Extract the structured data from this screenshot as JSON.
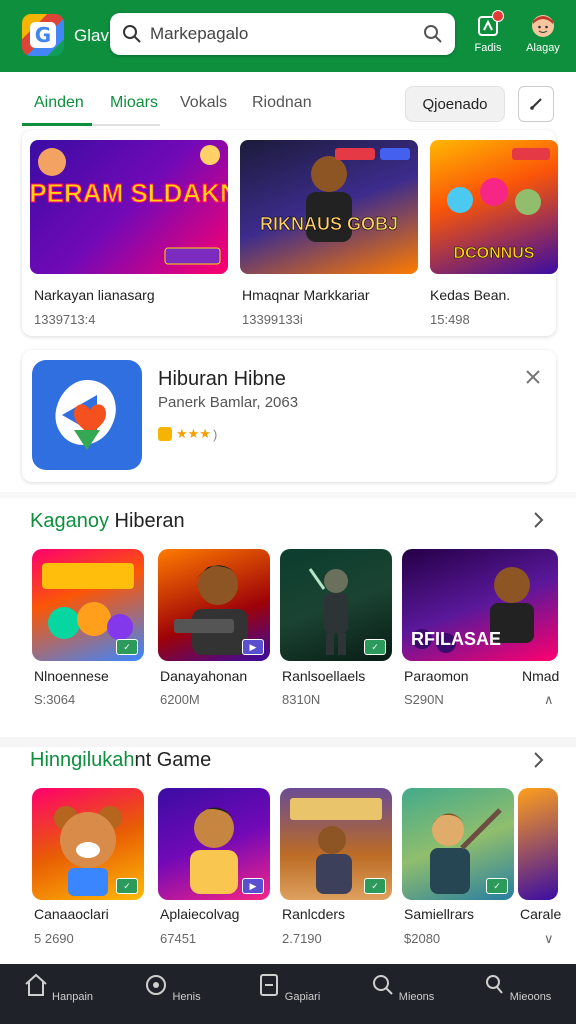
{
  "header": {
    "brand": "Glavn",
    "search_placeholder": "Markepagalo",
    "icons": [
      {
        "name": "notifications-icon",
        "label": "Fadis"
      },
      {
        "name": "avatar",
        "label": "Alagay"
      }
    ]
  },
  "tabs": [
    {
      "label": "Ainden",
      "active": true
    },
    {
      "label": "Mioars",
      "active": false
    },
    {
      "label": "Vokals",
      "active": false
    },
    {
      "label": "Riodnan",
      "active": false
    }
  ],
  "toolbar": {
    "chip_label": "Qjoenado"
  },
  "featured": [
    {
      "title": "Narkayan lianasarg",
      "sub": "1339713:4",
      "art": "SAPERAM SLDAKNIN"
    },
    {
      "title": "Hmaqnar Markkariar",
      "sub": "13399133i",
      "art": "RIKNAUS GOBJ"
    },
    {
      "title": "Kedas Bean.",
      "sub": "15:498",
      "art": "DCONNUS"
    }
  ],
  "promo": {
    "title": "Hiburan Hibne",
    "subtitle": "Panerk Bamlar, 2063",
    "rating": "★★★"
  },
  "sections": [
    {
      "title_hl": "Kaganoy",
      "title_rest": " Hiberan",
      "items": [
        {
          "title": "Nlnoennese",
          "sub": "S:3064",
          "tag": "✓"
        },
        {
          "title": "Danayahonan",
          "sub": "6200M",
          "tag": "▶"
        },
        {
          "title": "Ranlsoellaels",
          "sub": "8310N",
          "tag": "✓"
        },
        {
          "title": "Paraomon",
          "sub": "S290N",
          "art": "RFILASAE"
        },
        {
          "title": "Nmad",
          "sub": "∧"
        }
      ]
    },
    {
      "title_hl": "Hinngilukah",
      "title_rest": "nt Game",
      "items": [
        {
          "title": "Canaaoclari",
          "sub": "5 2690",
          "tag": "✓"
        },
        {
          "title": "Aplaiecolvag",
          "sub": "67451",
          "tag": "▶"
        },
        {
          "title": "Ranlcders",
          "sub": "2.7190",
          "tag": "✓"
        },
        {
          "title": "Samiellrars",
          "sub": "$2080",
          "tag": "✓"
        },
        {
          "title": "Carale",
          "sub": "∨"
        }
      ]
    }
  ],
  "bottom_nav": [
    {
      "label": "Hanpain",
      "icon": "home-icon"
    },
    {
      "label": "Henis",
      "icon": "apps-icon"
    },
    {
      "label": "Gapiari",
      "icon": "library-icon"
    },
    {
      "label": "Mieons",
      "icon": "search-icon"
    },
    {
      "label": "Mieoons",
      "icon": "profile-icon"
    }
  ],
  "colors": {
    "brand_green": "#0d8f3e",
    "bottom_bar": "#1f2228"
  }
}
